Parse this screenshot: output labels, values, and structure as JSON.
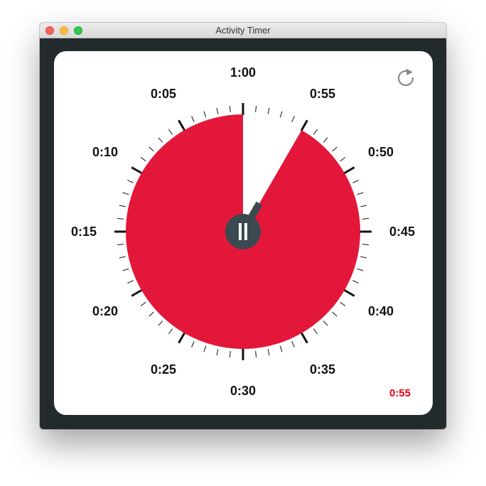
{
  "window": {
    "title": "Activity Timer"
  },
  "timer": {
    "remaining_label": "0:55",
    "remaining_minutes": 55,
    "total_minutes": 60,
    "state": "running",
    "dial_labels": [
      "1:00",
      "0:55",
      "0:50",
      "0:45",
      "0:40",
      "0:35",
      "0:30",
      "0:25",
      "0:20",
      "0:15",
      "0:10",
      "0:05"
    ]
  },
  "controls": {
    "pause_icon": "pause-icon",
    "reset_icon": "reset-icon"
  },
  "colors": {
    "window_frame": "#222a2d",
    "remaining_fill": "#e3173a",
    "knob": "#3b4a51",
    "ticks": "#111111",
    "remaining_text": "#e8001c",
    "reset_icon": "#8a8a8a"
  }
}
